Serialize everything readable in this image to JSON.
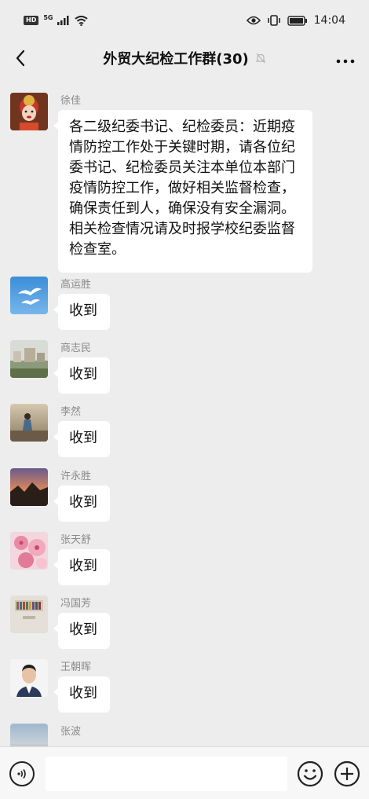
{
  "status_bar": {
    "hd_label": "HD",
    "network_label": "5G",
    "time": "14:04"
  },
  "header": {
    "title": "外贸大纪检工作群(30)",
    "back_icon": "chevron-left-icon",
    "mute_icon": "bell-muted-icon",
    "more_icon": "more-dots-icon"
  },
  "messages": [
    {
      "sender": "徐佳",
      "text": "各二级纪委书记、纪检委员：近期疫情防控工作处于关键时期，请各位纪委书记、纪检委员关注本单位本部门疫情防控工作，做好相关监督检查，确保责任到人，确保没有安全漏洞。相关检查情况请及时报学校纪委监督检查室。",
      "avatar": "opera-mask-avatar"
    },
    {
      "sender": "高运胜",
      "text": "收到",
      "avatar": "cranes-avatar"
    },
    {
      "sender": "商志民",
      "text": "收到",
      "avatar": "landscape-avatar"
    },
    {
      "sender": "李然",
      "text": "收到",
      "avatar": "figure-avatar"
    },
    {
      "sender": "许永胜",
      "text": "收到",
      "avatar": "sunset-avatar"
    },
    {
      "sender": "张天舒",
      "text": "收到",
      "avatar": "blossom-avatar"
    },
    {
      "sender": "冯国芳",
      "text": "收到",
      "avatar": "bookshelf-avatar"
    },
    {
      "sender": "王朝晖",
      "text": "收到",
      "avatar": "portrait-avatar"
    },
    {
      "sender": "张波",
      "text": "",
      "avatar": "sky-avatar"
    }
  ],
  "input_bar": {
    "voice_icon": "voice-icon",
    "emoji_icon": "emoji-icon",
    "plus_icon": "plus-icon"
  }
}
